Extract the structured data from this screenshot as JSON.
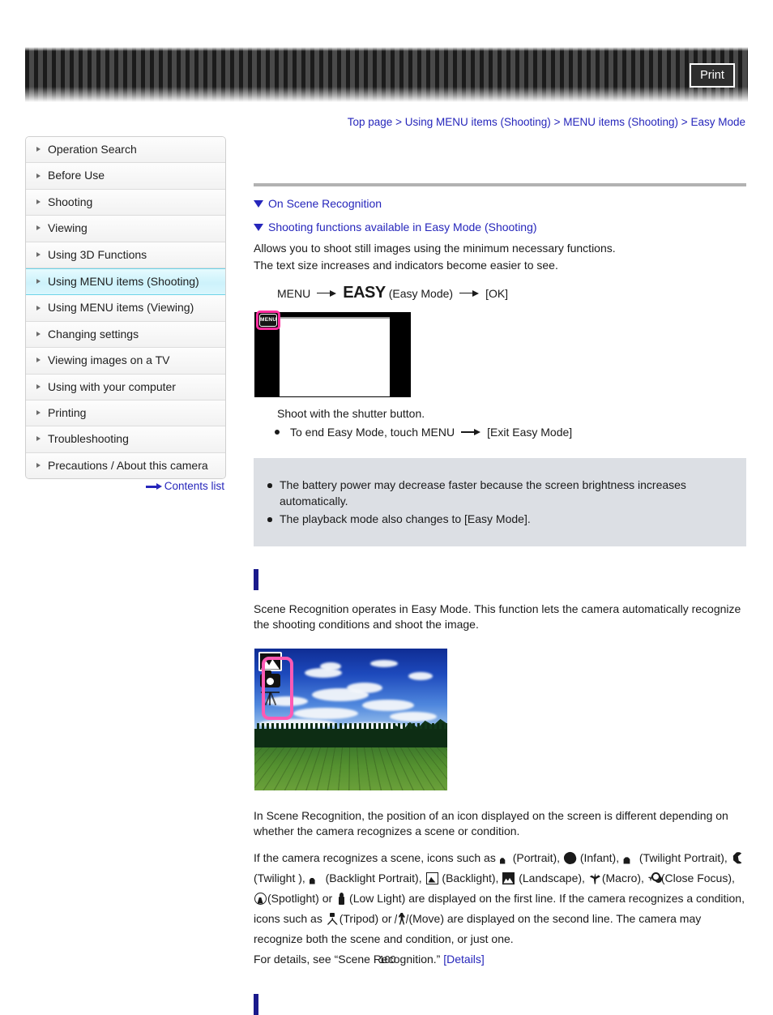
{
  "header": {
    "print_label": "Print"
  },
  "breadcrumb": {
    "items": [
      "Top page",
      "Using MENU items (Shooting)",
      "MENU items (Shooting)",
      "Easy Mode"
    ],
    "separator": ">"
  },
  "sidebar": {
    "items": [
      {
        "label": "Operation Search",
        "active": false
      },
      {
        "label": "Before Use",
        "active": false
      },
      {
        "label": "Shooting",
        "active": false
      },
      {
        "label": "Viewing",
        "active": false
      },
      {
        "label": "Using 3D Functions",
        "active": false
      },
      {
        "label": "Using MENU items (Shooting)",
        "active": true
      },
      {
        "label": "Using MENU items (Viewing)",
        "active": false
      },
      {
        "label": "Changing settings",
        "active": false
      },
      {
        "label": "Viewing images on a TV",
        "active": false
      },
      {
        "label": "Using with your computer",
        "active": false
      },
      {
        "label": "Printing",
        "active": false
      },
      {
        "label": "Troubleshooting",
        "active": false
      },
      {
        "label": "Precautions / About this camera",
        "active": false
      }
    ],
    "contents_list_label": "Contents list",
    "active_color": "#cdf2fb",
    "active_border_color": "#6fd3e8"
  },
  "content": {
    "anchors": [
      "On Scene Recognition",
      "Shooting functions available in Easy Mode (Shooting)"
    ],
    "intro_line_1": "Allows you to shoot still images using the minimum necessary functions.",
    "intro_line_2": "The text size increases and indicators become easier to see.",
    "menu_path": {
      "start": "MENU",
      "easy_glyph": "EASY",
      "easy_label": "(Easy Mode)",
      "end": "[OK]"
    },
    "figure_menu_icon_text": "MENU",
    "shoot_caption": "Shoot with the shutter button.",
    "exit_bullet_before": "To end Easy Mode, touch MENU",
    "exit_bullet_after": "[Exit Easy Mode]",
    "notes": [
      "The battery power may decrease faster because the screen brightness increases automatically.",
      "The playback mode also changes to [Easy Mode]."
    ],
    "scene_recognition_paragraph": "Scene Recognition operates in Easy Mode. This function lets the camera automatically recognize the shooting conditions and shoot the image.",
    "icon_position_paragraph": "In Scene Recognition, the position of an icon displayed on the screen is different depending on whether the camera recognizes a scene or condition.",
    "scene_icons_text": {
      "lead": "If the camera recognizes a scene, icons such as",
      "portrait": "(Portrait),",
      "infant": "(Infant),",
      "twilight_portrait": "(Twilight Portrait),",
      "twilight": "(Twilight ),",
      "backlight_portrait": "(Backlight Portrait),",
      "backlight": "(Backlight),",
      "landscape": "(Landscape),",
      "macro": "(Macro),",
      "close_focus": "(Close Focus),",
      "spotlight": "(Spotlight) or",
      "low_light": "(Low Light) are displayed on the first line. If the camera recognizes a condition, icons such as",
      "tripod": "(Tripod) or",
      "move": "(Move) are displayed on the second line. The camera may recognize both the scene and condition, or just one."
    },
    "details_line_prefix": "For details, see “Scene Recognition.”",
    "details_link_label": "[Details]",
    "section_marker_color": "#1a1a8c"
  },
  "footer": {
    "page_number": "100"
  }
}
